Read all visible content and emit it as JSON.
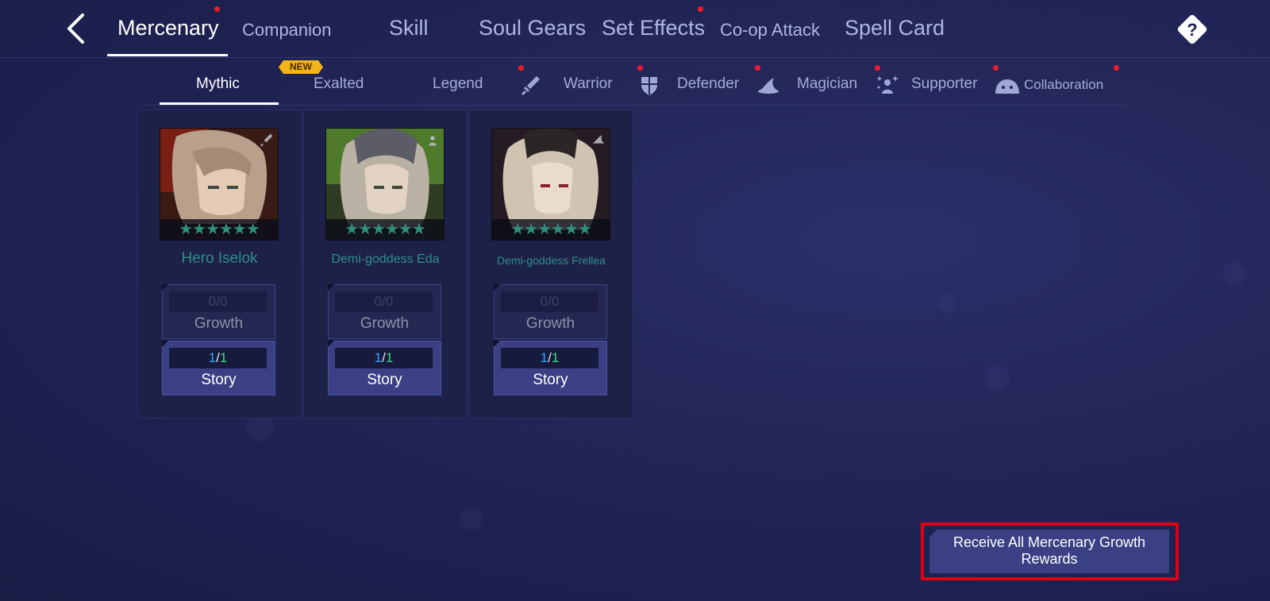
{
  "top_tabs": [
    "Mercenary",
    "Companion",
    "Skill",
    "Soul Gears",
    "Set Effects",
    "Co-op Attack",
    "Spell Card"
  ],
  "sub_tabs": [
    "Mythic",
    "Exalted",
    "Legend",
    "Warrior",
    "Defender",
    "Magician",
    "Supporter",
    "Collaboration"
  ],
  "new_badge": "NEW",
  "cards": [
    {
      "name": "Hero Iselok",
      "stars": "★★★★★★",
      "growth": {
        "current": "0",
        "sep": "/",
        "total": "0",
        "label": "Growth"
      },
      "story": {
        "current": "1",
        "sep": "/",
        "total": "1",
        "label": "Story"
      }
    },
    {
      "name": "Demi-goddess Eda",
      "stars": "★★★★★★",
      "growth": {
        "current": "0",
        "sep": "/",
        "total": "0",
        "label": "Growth"
      },
      "story": {
        "current": "1",
        "sep": "/",
        "total": "1",
        "label": "Story"
      }
    },
    {
      "name": "Demi-goddess Frellea",
      "stars": "★★★★★★",
      "growth": {
        "current": "0",
        "sep": "/",
        "total": "0",
        "label": "Growth"
      },
      "story": {
        "current": "1",
        "sep": "/",
        "total": "1",
        "label": "Story"
      }
    }
  ],
  "receive_all": {
    "line1": "Receive All Mercenary Growth",
    "line2": "Rewards"
  },
  "icons": {
    "back": "chevron-left-icon",
    "help": "question-diamond-icon",
    "warrior": "sword-icon",
    "defender": "shield-icon",
    "magician": "witch-hat-icon",
    "supporter": "sparkle-person-icon",
    "collaboration": "slime-icon"
  },
  "colors": {
    "accent_dot": "#ee1c2b",
    "story_current": "#35a7ff",
    "story_total": "#38e07a",
    "highlight_border": "#e00014"
  }
}
